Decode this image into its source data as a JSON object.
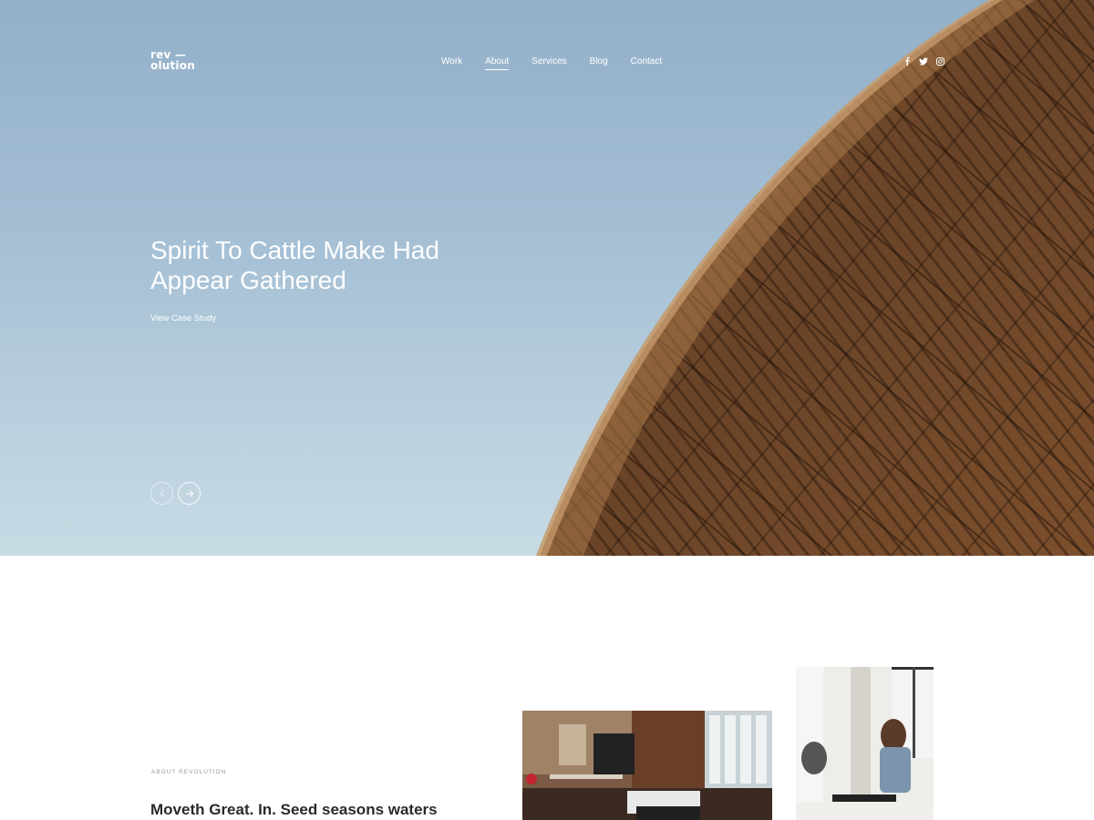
{
  "brand": {
    "logo_line1": "rev —",
    "logo_line2": "olution"
  },
  "nav": {
    "items": [
      {
        "label": "Work",
        "active": false
      },
      {
        "label": "About",
        "active": true
      },
      {
        "label": "Services",
        "active": false
      },
      {
        "label": "Blog",
        "active": false
      },
      {
        "label": "Contact",
        "active": false
      }
    ]
  },
  "social": {
    "icons": [
      "facebook-icon",
      "twitter-icon",
      "instagram-icon"
    ]
  },
  "hero": {
    "title": "Spirit To Cattle Make Had Appear Gathered",
    "cta_label": "View Case Study",
    "prev_icon": "chevron-left-icon",
    "next_icon": "arrow-right-icon",
    "sky_color": "#a6c0d5",
    "wood_color": "#7a5232"
  },
  "about": {
    "eyebrow": "ABOUT REVOLUTION",
    "heading": "Moveth Great. In. Seed seasons waters"
  },
  "colors": {
    "text_dark": "#2a2a2a",
    "muted": "#9a9a9a",
    "white": "#ffffff"
  }
}
